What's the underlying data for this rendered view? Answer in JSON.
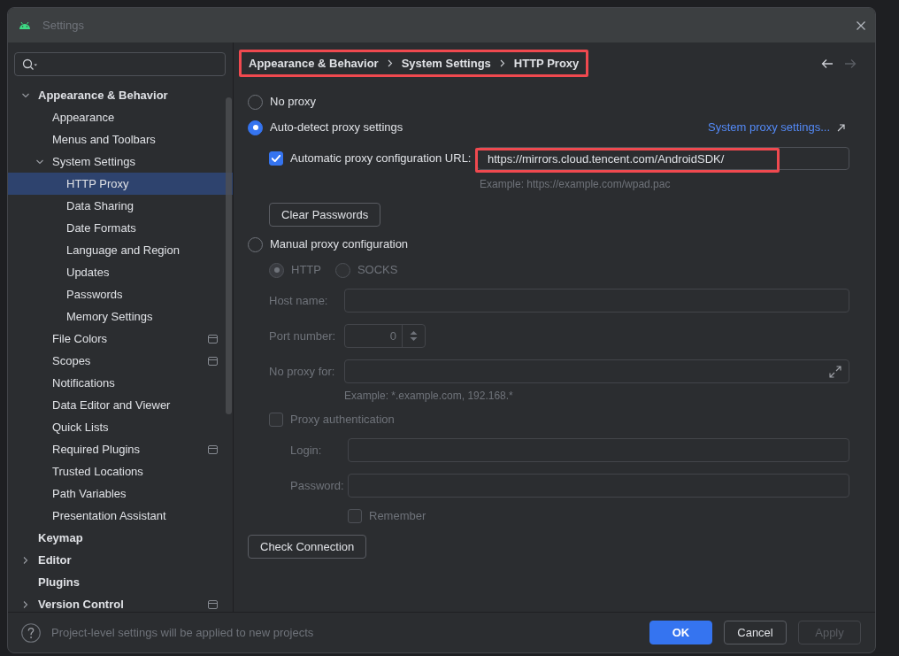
{
  "window": {
    "title": "Settings"
  },
  "sidebar": {
    "items": [
      {
        "label": "Appearance & Behavior",
        "selected": false,
        "expanded": true,
        "children": [
          {
            "label": "Appearance",
            "selected": false
          },
          {
            "label": "Menus and Toolbars",
            "selected": false
          },
          {
            "label": "System Settings",
            "selected": false,
            "expanded": true,
            "children": [
              {
                "label": "HTTP Proxy",
                "selected": true
              },
              {
                "label": "Data Sharing",
                "selected": false
              },
              {
                "label": "Date Formats",
                "selected": false
              },
              {
                "label": "Language and Region",
                "selected": false
              },
              {
                "label": "Updates",
                "selected": false
              },
              {
                "label": "Passwords",
                "selected": false
              },
              {
                "label": "Memory Settings",
                "selected": false
              }
            ]
          },
          {
            "label": "File Colors",
            "selected": false,
            "project_level": true
          },
          {
            "label": "Scopes",
            "selected": false,
            "project_level": true
          },
          {
            "label": "Notifications",
            "selected": false
          },
          {
            "label": "Data Editor and Viewer",
            "selected": false
          },
          {
            "label": "Quick Lists",
            "selected": false
          },
          {
            "label": "Required Plugins",
            "selected": false,
            "project_level": true
          },
          {
            "label": "Trusted Locations",
            "selected": false
          },
          {
            "label": "Path Variables",
            "selected": false
          },
          {
            "label": "Presentation Assistant",
            "selected": false
          }
        ]
      },
      {
        "label": "Keymap",
        "selected": false
      },
      {
        "label": "Editor",
        "selected": false,
        "expanded": false
      },
      {
        "label": "Plugins",
        "selected": false
      },
      {
        "label": "Version Control",
        "selected": false,
        "expanded": false,
        "project_level": true
      }
    ]
  },
  "breadcrumb": {
    "highlighted": true,
    "items": [
      "Appearance & Behavior",
      "System Settings",
      "HTTP Proxy"
    ]
  },
  "navigation": {
    "back_enabled": true,
    "forward_enabled": false
  },
  "no_proxy": {
    "label": "No proxy",
    "selected": false
  },
  "auto_detect": {
    "label": "Auto-detect proxy settings",
    "selected": true,
    "link": "System proxy settings...",
    "pac": {
      "checked": true,
      "label": "Automatic proxy configuration URL:",
      "value": "https://mirrors.cloud.tencent.com/AndroidSDK/",
      "highlighted": true,
      "hint": "Example: https://example.com/wpad.pac"
    },
    "clear_button": "Clear Passwords"
  },
  "manual": {
    "label": "Manual proxy configuration",
    "selected": false,
    "disabled": true,
    "protocols": [
      {
        "label": "HTTP",
        "selected": true
      },
      {
        "label": "SOCKS",
        "selected": false
      }
    ],
    "host": {
      "label": "Host name:"
    },
    "port": {
      "label": "Port number:",
      "value": "0"
    },
    "no_proxy_for": {
      "label": "No proxy for:",
      "hint": "Example: *.example.com, 192.168.*"
    },
    "auth": {
      "label": "Proxy authentication",
      "checked": false
    },
    "login": {
      "label": "Login:"
    },
    "password": {
      "label": "Password:"
    },
    "remember": {
      "label": "Remember",
      "checked": false
    }
  },
  "check_button": "Check Connection",
  "footer": {
    "hint": "Project-level settings will be applied to new projects",
    "buttons": [
      {
        "label": "OK",
        "kind": "primary"
      },
      {
        "label": "Cancel",
        "kind": "default"
      },
      {
        "label": "Apply",
        "kind": "disabled"
      }
    ]
  }
}
